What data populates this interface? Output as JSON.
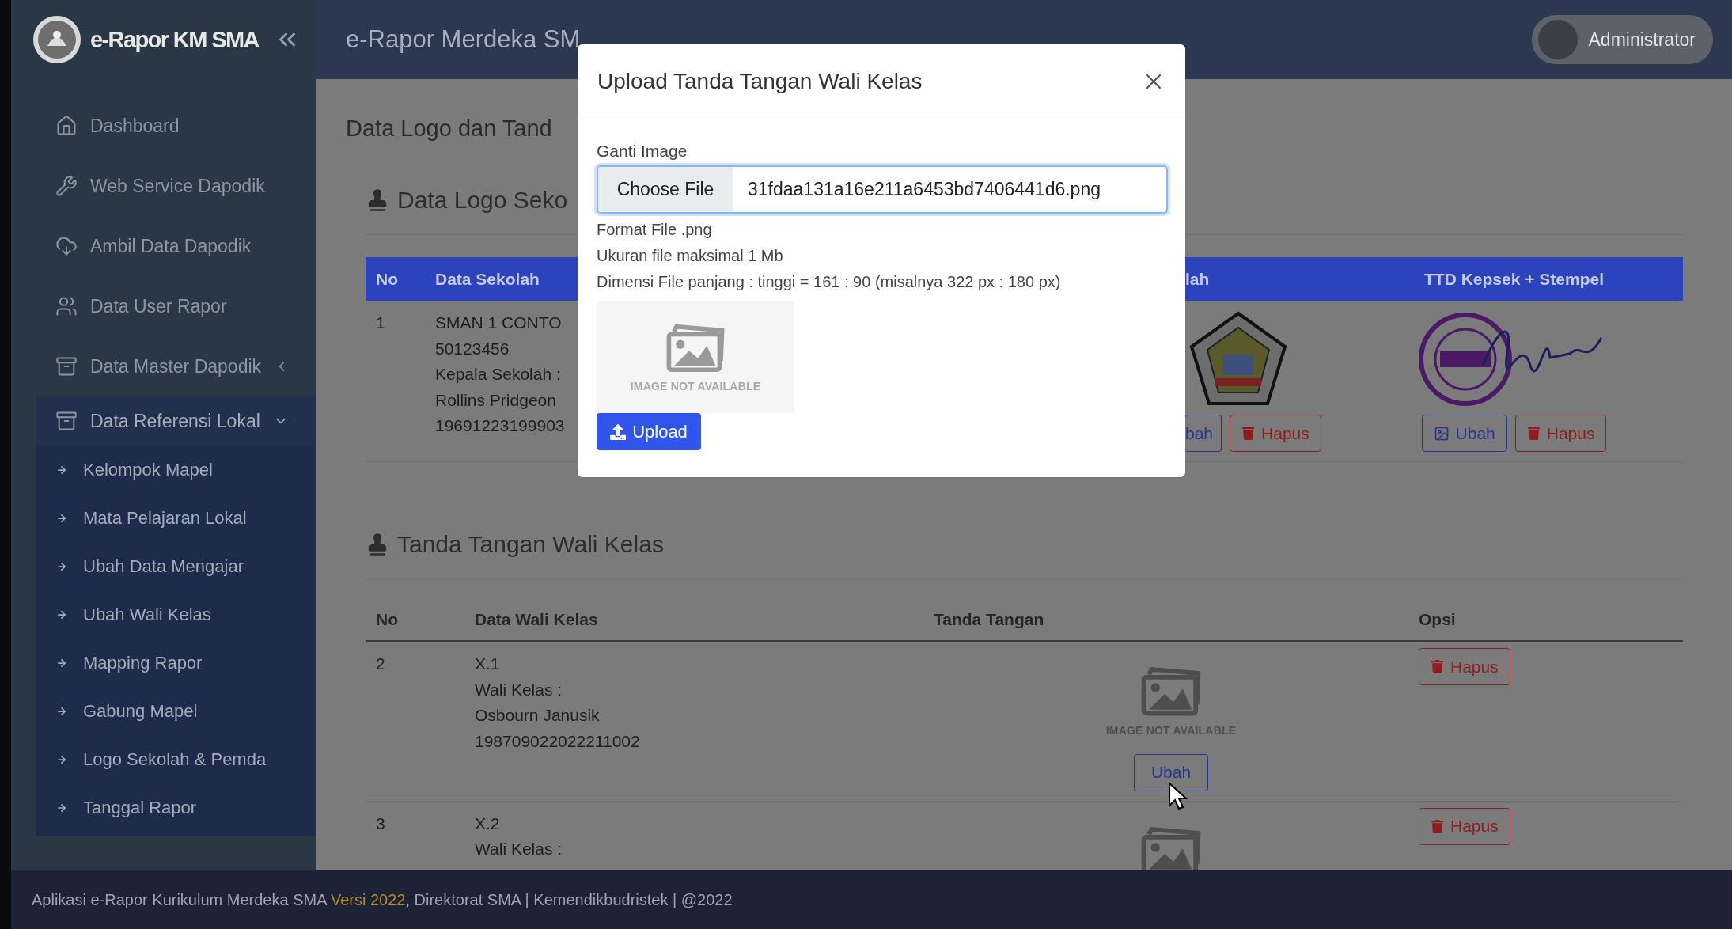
{
  "app": {
    "logo_text": "e-Rapor KM SMA"
  },
  "header": {
    "title": "e-Rapor Merdeka SM",
    "user": "Administrator"
  },
  "sidebar": {
    "items": [
      {
        "label": "Dashboard",
        "kind": "link"
      },
      {
        "label": "Web Service Dapodik",
        "kind": "link"
      },
      {
        "label": "Ambil Data Dapodik",
        "kind": "link"
      },
      {
        "label": "Data User Rapor",
        "kind": "link"
      },
      {
        "label": "Data Master Dapodik",
        "kind": "group",
        "expanded": false
      },
      {
        "label": "Data Referensi Lokal",
        "kind": "group",
        "expanded": true,
        "children": [
          {
            "label": "Kelompok Mapel"
          },
          {
            "label": "Mata Pelajaran Lokal"
          },
          {
            "label": "Ubah Data Mengajar"
          },
          {
            "label": "Ubah Wali Kelas"
          },
          {
            "label": "Mapping Rapor"
          },
          {
            "label": "Gabung Mapel"
          },
          {
            "label": "Logo Sekolah & Pemda"
          },
          {
            "label": "Tanggal Rapor"
          }
        ]
      }
    ]
  },
  "page": {
    "title": "Data Logo dan Tand",
    "logo_section": {
      "title": "Data Logo Seko",
      "columns": [
        "No",
        "Data Sekolah",
        "lah",
        "TTD Kepsek + Stempel"
      ],
      "rows": [
        {
          "no": "1",
          "lines": [
            "SMAN 1 CONTO",
            "50123456",
            "Kepala Sekolah :",
            "Rollins Pridgeon",
            "19691223199903"
          ],
          "logo_edit": "bah",
          "logo_delete": "Hapus",
          "ttd_edit": "Ubah",
          "ttd_delete": "Hapus"
        }
      ]
    },
    "signature_section": {
      "title": "Tanda Tangan Wali Kelas",
      "columns": [
        "No",
        "Data Wali Kelas",
        "Tanda Tangan",
        "Opsi"
      ],
      "rows": [
        {
          "no": "2",
          "lines": [
            "X.1",
            "Wali Kelas :",
            "Osbourn Janusik",
            "198709022022211002"
          ],
          "image_text": "IMAGE NOT AVAILABLE",
          "edit": "Ubah",
          "delete": "Hapus"
        },
        {
          "no": "3",
          "lines": [
            "X.2",
            "Wali Kelas :"
          ],
          "delete": "Hapus"
        }
      ]
    }
  },
  "modal": {
    "title": "Upload Tanda Tangan Wali Kelas",
    "field_label": "Ganti Image",
    "file_button": "Choose File",
    "file_name": "31fdaa131a16e211a6453bd7406441d6.png",
    "hints": [
      "Format File .png",
      "Ukuran file maksimal 1 Mb",
      "Dimensi File panjang : tinggi = 161 : 90 (misalnya 322 px : 180 px)"
    ],
    "preview_text": "IMAGE NOT AVAILABLE",
    "upload_button": "Upload"
  },
  "footer": {
    "text_before": "Aplikasi e-Rapor Kurikulum Merdeka SMA ",
    "version": "Versi 2022",
    "text_after": ", Direktorat SMA | Kemendikbudristek | @2022"
  }
}
